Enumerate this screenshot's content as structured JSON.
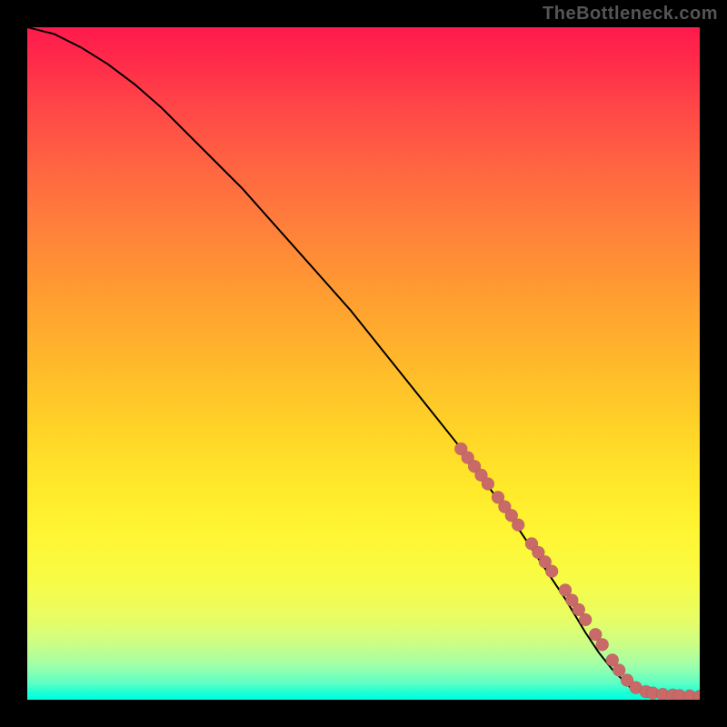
{
  "watermark": "TheBottleneck.com",
  "chart_data": {
    "type": "line",
    "title": "",
    "xlabel": "",
    "ylabel": "",
    "xlim": [
      0,
      100
    ],
    "ylim": [
      0,
      100
    ],
    "grid": false,
    "legend": false,
    "series": [
      {
        "name": "curve",
        "x": [
          0,
          4,
          8,
          12,
          16,
          20,
          24,
          28,
          32,
          36,
          40,
          44,
          48,
          52,
          56,
          60,
          64,
          68,
          72,
          76,
          80,
          83,
          85,
          87,
          89,
          90,
          92,
          94,
          96,
          98,
          100
        ],
        "y": [
          100,
          99,
          97,
          94.5,
          91.5,
          88,
          84,
          80,
          76,
          71.5,
          67,
          62.5,
          58,
          53,
          48,
          43,
          38,
          32.5,
          27,
          21,
          15,
          10,
          7,
          4.5,
          2.5,
          1.5,
          1.0,
          0.7,
          0.5,
          0.5,
          0.5
        ]
      }
    ],
    "markers": {
      "name": "highlighted-points",
      "color": "#c96a68",
      "x": [
        64.5,
        65.5,
        66.5,
        67.5,
        68.5,
        70.0,
        71.0,
        72.0,
        73.0,
        75.0,
        76.0,
        77.0,
        78.0,
        80.0,
        81.0,
        82.0,
        83.0,
        84.5,
        85.5,
        87.0,
        88.0,
        89.2,
        90.5,
        92.0,
        93.0,
        94.5,
        96.0,
        97.0,
        98.5,
        100.0
      ],
      "y": [
        37.3,
        36.0,
        34.7,
        33.4,
        32.1,
        30.1,
        28.7,
        27.4,
        26.0,
        23.2,
        21.9,
        20.5,
        19.1,
        16.3,
        14.8,
        13.4,
        11.9,
        9.7,
        8.2,
        5.9,
        4.4,
        2.9,
        1.8,
        1.2,
        1.0,
        0.8,
        0.7,
        0.6,
        0.55,
        0.5
      ]
    }
  }
}
